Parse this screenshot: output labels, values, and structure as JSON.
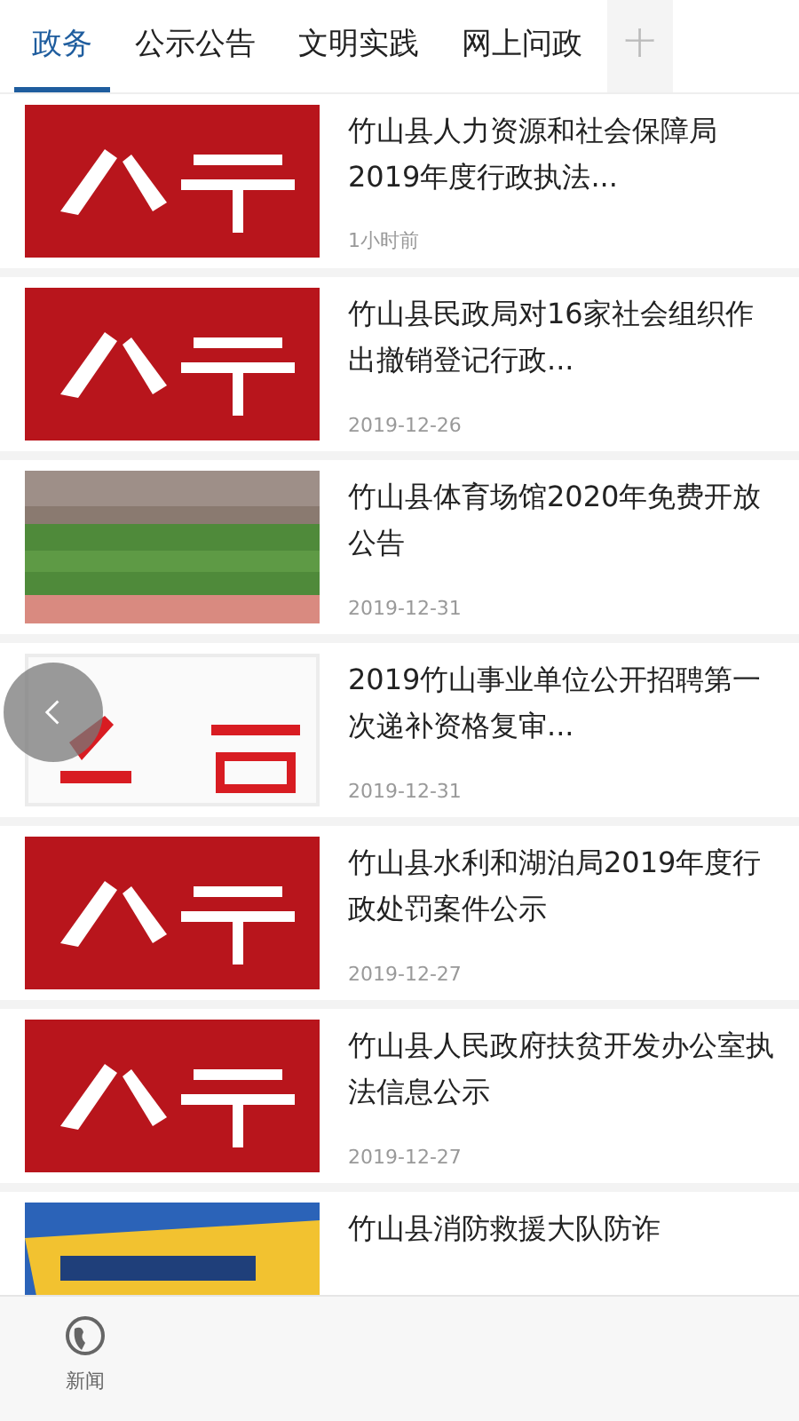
{
  "tabs": [
    {
      "label": "政务",
      "selected": true
    },
    {
      "label": "公示公告",
      "selected": false
    },
    {
      "label": "文明实践",
      "selected": false
    },
    {
      "label": "网上问政",
      "selected": false
    },
    {
      "label": "十",
      "selected": false
    }
  ],
  "news": [
    {
      "title": "竹山县人力资源和社会保障局2019年度行政执法...",
      "time": "1小时前",
      "kind": "red"
    },
    {
      "title": "竹山县民政局对16家社会组织作出撤销登记行政...",
      "time": "2019-12-26",
      "kind": "red"
    },
    {
      "title": "竹山县体育场馆2020年免费开放公告",
      "time": "2019-12-31",
      "kind": "field"
    },
    {
      "title": "2019竹山事业单位公开招聘第一次递补资格复审...",
      "time": "2019-12-31",
      "kind": "white"
    },
    {
      "title": "竹山县水利和湖泊局2019年度行政处罚案件公示",
      "time": "2019-12-27",
      "kind": "red"
    },
    {
      "title": "竹山县人民政府扶贫开发办公室执法信息公示",
      "time": "2019-12-27",
      "kind": "red"
    },
    {
      "title": "竹山县消防救援大队防诈",
      "kind": "banner"
    }
  ],
  "bottom_nav": [
    {
      "label": "新闻",
      "selected": false
    }
  ]
}
